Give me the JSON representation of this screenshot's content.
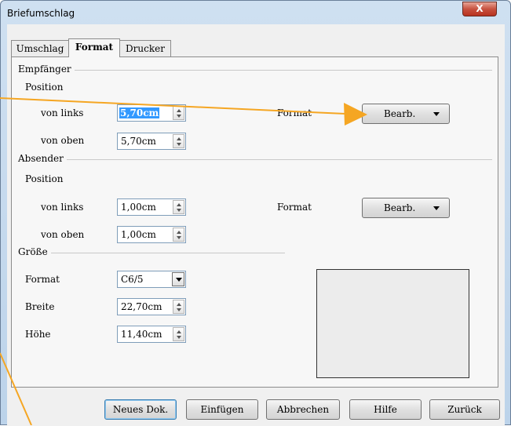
{
  "window": {
    "title": "Briefumschlag",
    "close_glyph": "X"
  },
  "tabs": [
    {
      "label": "Umschlag"
    },
    {
      "label": "Format"
    },
    {
      "label": "Drucker"
    }
  ],
  "empfaenger": {
    "section_label": "Empfänger",
    "position_label": "Position",
    "von_links": {
      "label": "von links",
      "value": "5,70cm"
    },
    "von_oben": {
      "label": "von oben",
      "value": "5,70cm"
    },
    "format_label": "Format",
    "bearb_label": "Bearb."
  },
  "absender": {
    "section_label": "Absender",
    "position_label": "Position",
    "von_links": {
      "label": "von links",
      "value": "1,00cm"
    },
    "von_oben": {
      "label": "von oben",
      "value": "1,00cm"
    },
    "format_label": "Format",
    "bearb_label": "Bearb."
  },
  "groesse": {
    "section_label": "Größe",
    "format": {
      "label": "Format",
      "value": "C6/5"
    },
    "breite": {
      "label": "Breite",
      "value": "22,70cm"
    },
    "hoehe": {
      "label": "Höhe",
      "value": "11,40cm"
    }
  },
  "buttons": {
    "neues_dok": "Neues Dok.",
    "einfuegen": "Einfügen",
    "abbrechen": "Abbrechen",
    "hilfe": "Hilfe",
    "zurueck": "Zurück"
  },
  "colors": {
    "annotation_arrow": "#f5a623",
    "selection": "#3399ff"
  },
  "icons": [
    "spin-up-icon",
    "spin-down-icon",
    "dropdown-arrow-icon",
    "close-icon"
  ]
}
